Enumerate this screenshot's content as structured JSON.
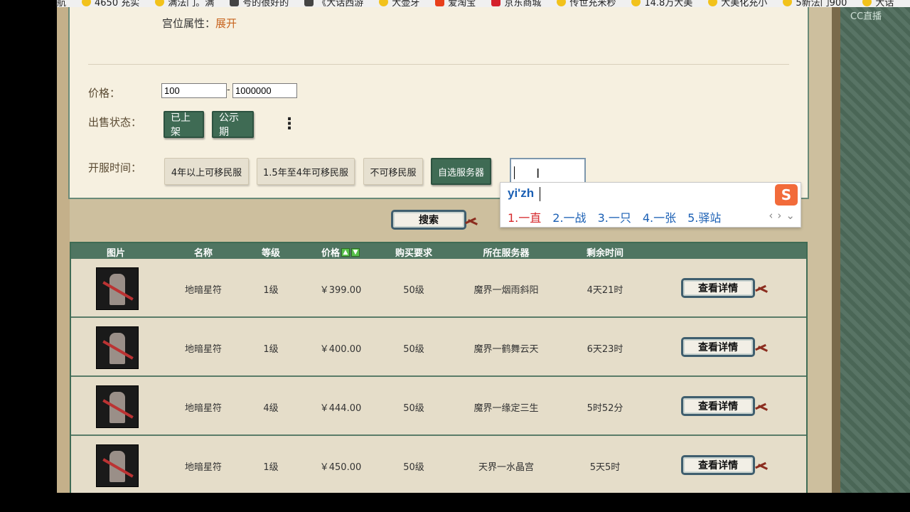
{
  "bookmarks": [
    {
      "label": "航",
      "icon": "none"
    },
    {
      "label": "4650 充实",
      "icon": "star-icon"
    },
    {
      "label": "满法门。满",
      "icon": "star-icon"
    },
    {
      "label": "号的很好的",
      "icon": "camera-icon"
    },
    {
      "label": "《大话西游",
      "icon": "camera-icon"
    },
    {
      "label": "大壶牙",
      "icon": "star-icon"
    },
    {
      "label": "爱淘宝",
      "icon": "taobao-icon"
    },
    {
      "label": "京东商城",
      "icon": "jd-icon"
    },
    {
      "label": "传世充米秒",
      "icon": "star-icon"
    },
    {
      "label": "14.8万大美",
      "icon": "star-icon"
    },
    {
      "label": "大美化充小",
      "icon": "star-icon"
    },
    {
      "label": "5新法门900",
      "icon": "star-icon"
    },
    {
      "label": "大话",
      "icon": "star-icon"
    }
  ],
  "cc_label": "CC直播",
  "filter": {
    "palace_label": "宫位属性：",
    "palace_value": "展开",
    "price_label": "价格：",
    "price_min": "100",
    "price_max": "1000000",
    "price_sep": "-",
    "sale_status_label": "出售状态：",
    "sale_on_shelf": "已上架",
    "sale_public": "公示期",
    "more_label": "⋮",
    "open_time_label": "开服时间：",
    "open_4y": "4年以上可移民服",
    "open_15_4y": "1.5年至4年可移民服",
    "open_no_move": "不可移民服",
    "open_choose_server": "自选服务器",
    "server_input_value": ""
  },
  "search_label": "搜索",
  "table": {
    "headers": [
      "图片",
      "名称",
      "等级",
      "价格",
      "购买要求",
      "所在服务器",
      "剩余时间"
    ],
    "detail_label": "查看详情",
    "rows": [
      {
        "name": "地暗星符",
        "level": "1级",
        "price": "￥399.00",
        "req": "50级",
        "server": "魔界一烟雨斜阳",
        "remaining": "4天21时"
      },
      {
        "name": "地暗星符",
        "level": "1级",
        "price": "￥400.00",
        "req": "50级",
        "server": "魔界一鹤舞云天",
        "remaining": "6天23时"
      },
      {
        "name": "地暗星符",
        "level": "4级",
        "price": "￥444.00",
        "req": "50级",
        "server": "魔界一缘定三生",
        "remaining": "5时52分"
      },
      {
        "name": "地暗星符",
        "level": "1级",
        "price": "￥450.00",
        "req": "50级",
        "server": "天界一水晶宫",
        "remaining": "5天5时"
      }
    ]
  },
  "ime": {
    "pinyin": "yi'zh",
    "logo": "S",
    "candidates": [
      "1.一直",
      "2.一战",
      "3.一只",
      "4.一张",
      "5.驿站"
    ],
    "prev": "‹",
    "next": "›",
    "expand": "⌄"
  },
  "colors": {
    "panel_green": "#3f6b54",
    "ime_blue": "#1a5fb4",
    "ime_red": "#d6292c",
    "palace_orange": "#c8641e"
  }
}
